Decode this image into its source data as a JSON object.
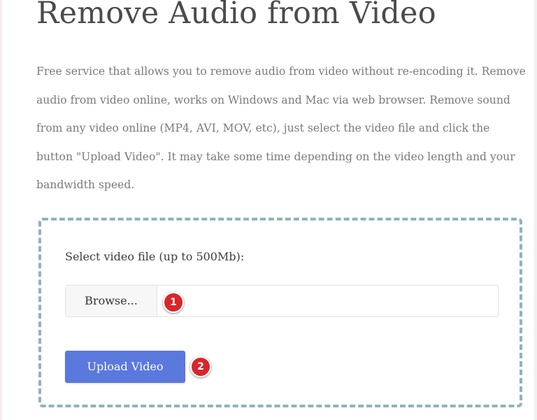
{
  "page": {
    "title": "Remove Audio from Video",
    "description": "Free service that allows you to remove audio from video without re-encoding it. Remove audio from video online, works on Windows and Mac via web browser. Remove sound from any video online (MP4, AVI, MOV, etc), just select the video file and click the button \"Upload Video\". It may take some time depending on the video length and your bandwidth speed."
  },
  "upload_form": {
    "file_label": "Select video file (up to 500Mb):",
    "browse_label": "Browse...",
    "upload_label": "Upload Video"
  },
  "annotations": {
    "marker_1": "1",
    "marker_2": "2"
  },
  "colors": {
    "accent_button": "#5b78dd",
    "dashed_border": "#8db4bb",
    "marker": "#d8262b",
    "title_text": "#4b4b4b",
    "body_text": "#7a7a7a"
  }
}
